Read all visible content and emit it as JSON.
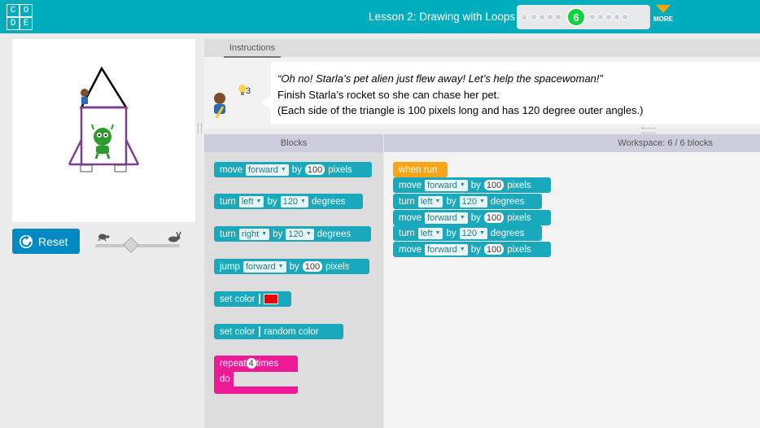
{
  "header": {
    "logo_letters": [
      "C",
      "O",
      "D",
      "E"
    ],
    "lesson_title": "Lesson 2: Drawing with Loops",
    "current_puzzle": "6",
    "more_label": "MORE",
    "accent": "#00adbc"
  },
  "controls": {
    "reset_label": "Reset",
    "speed": {
      "min_icon": "turtle-icon",
      "max_icon": "rabbit-icon",
      "value": 0.4
    }
  },
  "instructions": {
    "tab_label": "Instructions",
    "hint_count": "3",
    "line1": "“Oh no! Starla’s pet alien just flew away! Let’s help the spacewoman!”",
    "line2": "Finish Starla’s rocket so she can chase her pet.",
    "line3": "(Each side of the triangle is 100 pixels long and has 120 degree outer angles.)"
  },
  "toolbox": {
    "header": "Blocks",
    "move": {
      "label": "move",
      "dir": "forward",
      "by": "by",
      "num": "100",
      "unit": "pixels"
    },
    "turn_left": {
      "label": "turn",
      "dir": "left",
      "by": "by",
      "num": "120",
      "unit": "degrees"
    },
    "turn_right": {
      "label": "turn",
      "dir": "right",
      "by": "by",
      "num": "120",
      "unit": "degrees"
    },
    "jump": {
      "label": "jump",
      "dir": "forward",
      "by": "by",
      "num": "100",
      "unit": "pixels"
    },
    "set_color": {
      "label": "set color",
      "color": "#ee0000"
    },
    "set_random": {
      "label": "set color",
      "value": "random color"
    },
    "repeat": {
      "label": "repeat",
      "num": "4",
      "times": "times",
      "do": "do"
    }
  },
  "workspace": {
    "header": "Workspace: 6 / 6 blocks",
    "hat": "when run",
    "blocks": [
      {
        "label": "move",
        "dir": "forward",
        "by": "by",
        "num": "100",
        "unit": "pixels"
      },
      {
        "label": "turn",
        "dir": "left",
        "by": "by",
        "num": "120",
        "unit": "degrees"
      },
      {
        "label": "move",
        "dir": "forward",
        "by": "by",
        "num": "100",
        "unit": "pixels"
      },
      {
        "label": "turn",
        "dir": "left",
        "by": "by",
        "num": "120",
        "unit": "degrees"
      },
      {
        "label": "move",
        "dir": "forward",
        "by": "by",
        "num": "100",
        "unit": "pixels"
      }
    ]
  }
}
